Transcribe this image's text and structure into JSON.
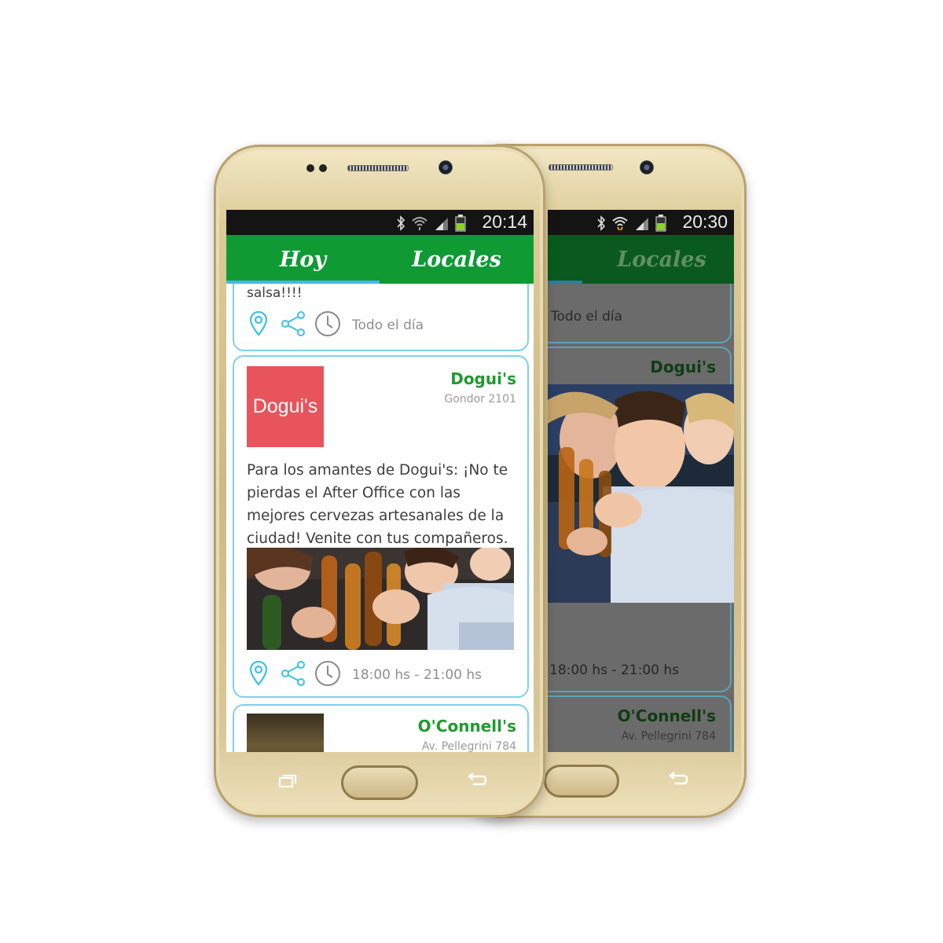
{
  "front_screen": {
    "status": {
      "time": "20:14"
    },
    "tabs": [
      {
        "label": "Hoy",
        "selected": true
      },
      {
        "label": "Locales",
        "selected": false
      }
    ],
    "cards": [
      {
        "partial_text": "salsa!!!!",
        "time": "Todo el día"
      },
      {
        "logo_text": "Dogui's",
        "name": "Dogui's",
        "address": "Gondor 2101",
        "description": "Para los amantes de Dogui's: ¡No te pierdas el After Office con las mejores cervezas artesanales de la ciudad! Venite con tus compañeros.",
        "time": "18:00 hs - 21:00 hs"
      },
      {
        "name": "O'Connell's",
        "address": "Av. Pellegrini 784"
      }
    ]
  },
  "back_screen": {
    "status": {
      "time": "20:30"
    },
    "tabs": [
      {
        "label": "Locales"
      }
    ],
    "cards": [
      {
        "time": "Todo el día"
      },
      {
        "name": "Dogui's",
        "time": "18:00 hs - 21:00 hs"
      },
      {
        "name": "O'Connell's",
        "address": "Av. Pellegrini 784"
      }
    ]
  },
  "colors": {
    "app_green": "#0f9a34",
    "dark_green": "#0a5a1f",
    "accent_blue": "#45b7e6",
    "card_border": "#7fd0ec",
    "logo_red": "#e8545c",
    "gold": "#d4c08c"
  },
  "icons": [
    "bluetooth-icon",
    "wifi-icon",
    "signal-icon",
    "battery-icon",
    "location-pin-icon",
    "share-icon",
    "clock-icon",
    "recent-apps-icon",
    "home-button",
    "back-icon"
  ]
}
